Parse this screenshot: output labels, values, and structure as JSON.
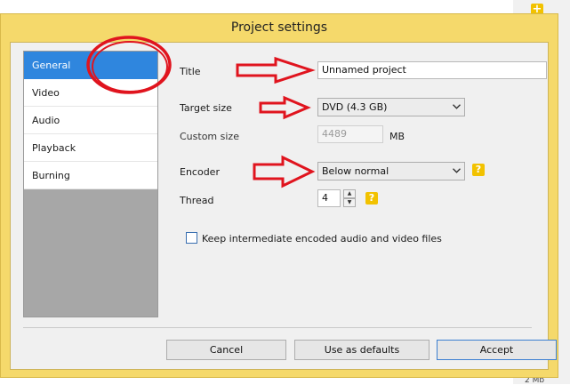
{
  "dialog": {
    "title": "Project settings"
  },
  "sidebar": {
    "items": [
      {
        "label": "General"
      },
      {
        "label": "Video"
      },
      {
        "label": "Audio"
      },
      {
        "label": "Playback"
      },
      {
        "label": "Burning"
      }
    ]
  },
  "form": {
    "title_label": "Title",
    "title_value": "Unnamed project",
    "target_size_label": "Target size",
    "target_size_value": "DVD (4.3 GB)",
    "custom_size_label": "Custom size",
    "custom_size_value": "4489",
    "custom_size_unit": "MB",
    "encoder_label": "Encoder",
    "encoder_value": "Below normal",
    "thread_label": "Thread",
    "thread_value": "4",
    "help_glyph": "?",
    "keep_files_label": "Keep intermediate encoded audio and video files"
  },
  "buttons": {
    "cancel": "Cancel",
    "defaults": "Use as defaults",
    "accept": "Accept"
  },
  "background": {
    "plus": "+",
    "size_text": "2 Mb"
  },
  "colors": {
    "dialog_frame": "#f5d96b",
    "selection": "#2f86de",
    "help": "#f2c200",
    "annotation": "#e0141e"
  },
  "icons": {
    "dropdown": "chevron-down-icon",
    "help": "help-icon",
    "spinner_up": "triangle-up-icon",
    "spinner_down": "triangle-down-icon",
    "arrow": "right-arrow-annotation",
    "circle": "circle-annotation"
  }
}
